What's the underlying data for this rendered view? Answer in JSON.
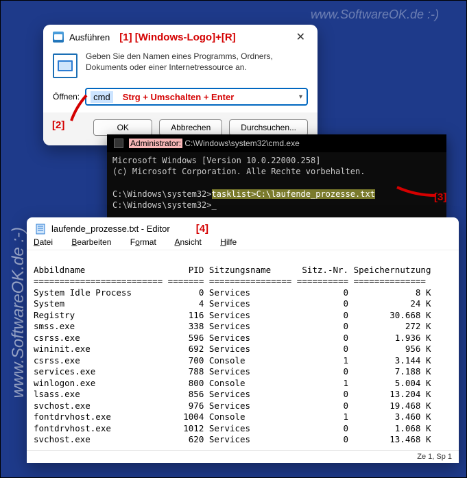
{
  "watermarks": {
    "top": "www.SoftwareOK.de :-)",
    "mid": "www.SoftwareOK.de :-)",
    "side": "www.SoftwareOK.de :-)"
  },
  "annotations": {
    "a1": "[1] [Windows-Logo]+[R]",
    "a2": "[2]",
    "a3": "[3]",
    "a4": "[4]"
  },
  "run": {
    "title": "Ausführen",
    "desc": "Geben Sie den Namen eines Programms, Ordners, Dokuments oder einer Internetressource an.",
    "open_label": "Öffnen:",
    "value": "cmd",
    "hint": "Strg + Umschalten + Enter",
    "ok": "OK",
    "cancel": "Abbrechen",
    "browse": "Durchsuchen..."
  },
  "cmd": {
    "title_admin": "Administrator:",
    "title_path": " C:\\Windows\\system32\\cmd.exe",
    "line1": "Microsoft Windows [Version 10.0.22000.258]",
    "line2": "(c) Microsoft Corporation. Alle Rechte vorbehalten.",
    "prompt1": "C:\\Windows\\system32>",
    "command": "tasklist>C:\\laufende_prozesse.txt",
    "prompt2": "C:\\Windows\\system32>"
  },
  "notepad": {
    "title": "laufende_prozesse.txt - Editor",
    "menu": {
      "datei": "Datei",
      "bearbeiten": "Bearbeiten",
      "format": "Format",
      "ansicht": "Ansicht",
      "hilfe": "Hilfe"
    },
    "status": "Ze 1, Sp 1",
    "hdr": {
      "name": "Abbildname",
      "pid": "PID",
      "session": "Sitzungsname",
      "snr": "Sitz.-Nr.",
      "mem": "Speichernutzung"
    },
    "rows": [
      {
        "name": "System Idle Process",
        "pid": "0",
        "session": "Services",
        "snr": "0",
        "mem": "8 K"
      },
      {
        "name": "System",
        "pid": "4",
        "session": "Services",
        "snr": "0",
        "mem": "24 K"
      },
      {
        "name": "Registry",
        "pid": "116",
        "session": "Services",
        "snr": "0",
        "mem": "30.668 K"
      },
      {
        "name": "smss.exe",
        "pid": "338",
        "session": "Services",
        "snr": "0",
        "mem": "272 K"
      },
      {
        "name": "csrss.exe",
        "pid": "596",
        "session": "Services",
        "snr": "0",
        "mem": "1.936 K"
      },
      {
        "name": "wininit.exe",
        "pid": "692",
        "session": "Services",
        "snr": "0",
        "mem": "956 K"
      },
      {
        "name": "csrss.exe",
        "pid": "700",
        "session": "Console",
        "snr": "1",
        "mem": "3.144 K"
      },
      {
        "name": "services.exe",
        "pid": "788",
        "session": "Services",
        "snr": "0",
        "mem": "7.188 K"
      },
      {
        "name": "winlogon.exe",
        "pid": "800",
        "session": "Console",
        "snr": "1",
        "mem": "5.004 K"
      },
      {
        "name": "lsass.exe",
        "pid": "856",
        "session": "Services",
        "snr": "0",
        "mem": "13.204 K"
      },
      {
        "name": "svchost.exe",
        "pid": "976",
        "session": "Services",
        "snr": "0",
        "mem": "19.468 K"
      },
      {
        "name": "fontdrvhost.exe",
        "pid": "1004",
        "session": "Console",
        "snr": "1",
        "mem": "3.460 K"
      },
      {
        "name": "fontdrvhost.exe",
        "pid": "1012",
        "session": "Services",
        "snr": "0",
        "mem": "1.068 K"
      },
      {
        "name": "svchost.exe",
        "pid": "620",
        "session": "Services",
        "snr": "0",
        "mem": "13.468 K"
      }
    ]
  }
}
